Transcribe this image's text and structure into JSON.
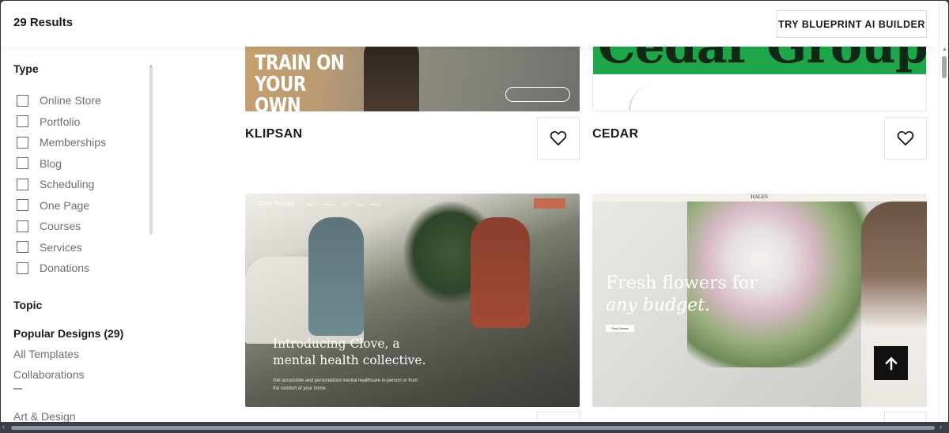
{
  "header": {
    "results_label": "29 Results",
    "ai_builder_button": "TRY BLUEPRINT AI BUILDER"
  },
  "sidebar": {
    "type_title": "Type",
    "type_options": [
      {
        "label": "Online Store",
        "checked": false
      },
      {
        "label": "Portfolio",
        "checked": false
      },
      {
        "label": "Memberships",
        "checked": false
      },
      {
        "label": "Blog",
        "checked": false
      },
      {
        "label": "Scheduling",
        "checked": false
      },
      {
        "label": "One Page",
        "checked": false
      },
      {
        "label": "Courses",
        "checked": false
      },
      {
        "label": "Services",
        "checked": false
      },
      {
        "label": "Donations",
        "checked": false
      }
    ],
    "topic_title": "Topic",
    "topics": [
      {
        "label": "Popular Designs (29)",
        "active": true
      },
      {
        "label": "All Templates",
        "active": false
      },
      {
        "label": "Collaborations",
        "active": false
      },
      {
        "label": "Art & Design",
        "active": false
      }
    ]
  },
  "templates": [
    {
      "name": "KLIPSAN",
      "preview_headline": "TRAIN ON YOUR OWN TIME.",
      "favorited": false
    },
    {
      "name": "CEDAR",
      "preview_headline": "Cedar Group",
      "favorited": false
    },
    {
      "name": "",
      "preview_brand": "Clove Therapy",
      "preview_nav": "About Sessions Team Blog Contact",
      "preview_headline": "Introducing Clove, a mental health collective.",
      "preview_sub": "Get accessible and personalized mental healthcare in-person or from the comfort of your home"
    },
    {
      "name": "",
      "preview_brand": "HALES",
      "preview_headline_1": "Fresh flowers for",
      "preview_headline_2": "any budget.",
      "preview_button": "Shop Flowers"
    }
  ],
  "icons": {
    "favorite": "heart-icon",
    "back_to_top": "arrow-up-icon"
  },
  "colors": {
    "cedar_green": "#1fa64a",
    "clove_cta": "#c66b4f",
    "back_to_top_bg": "#111111"
  }
}
